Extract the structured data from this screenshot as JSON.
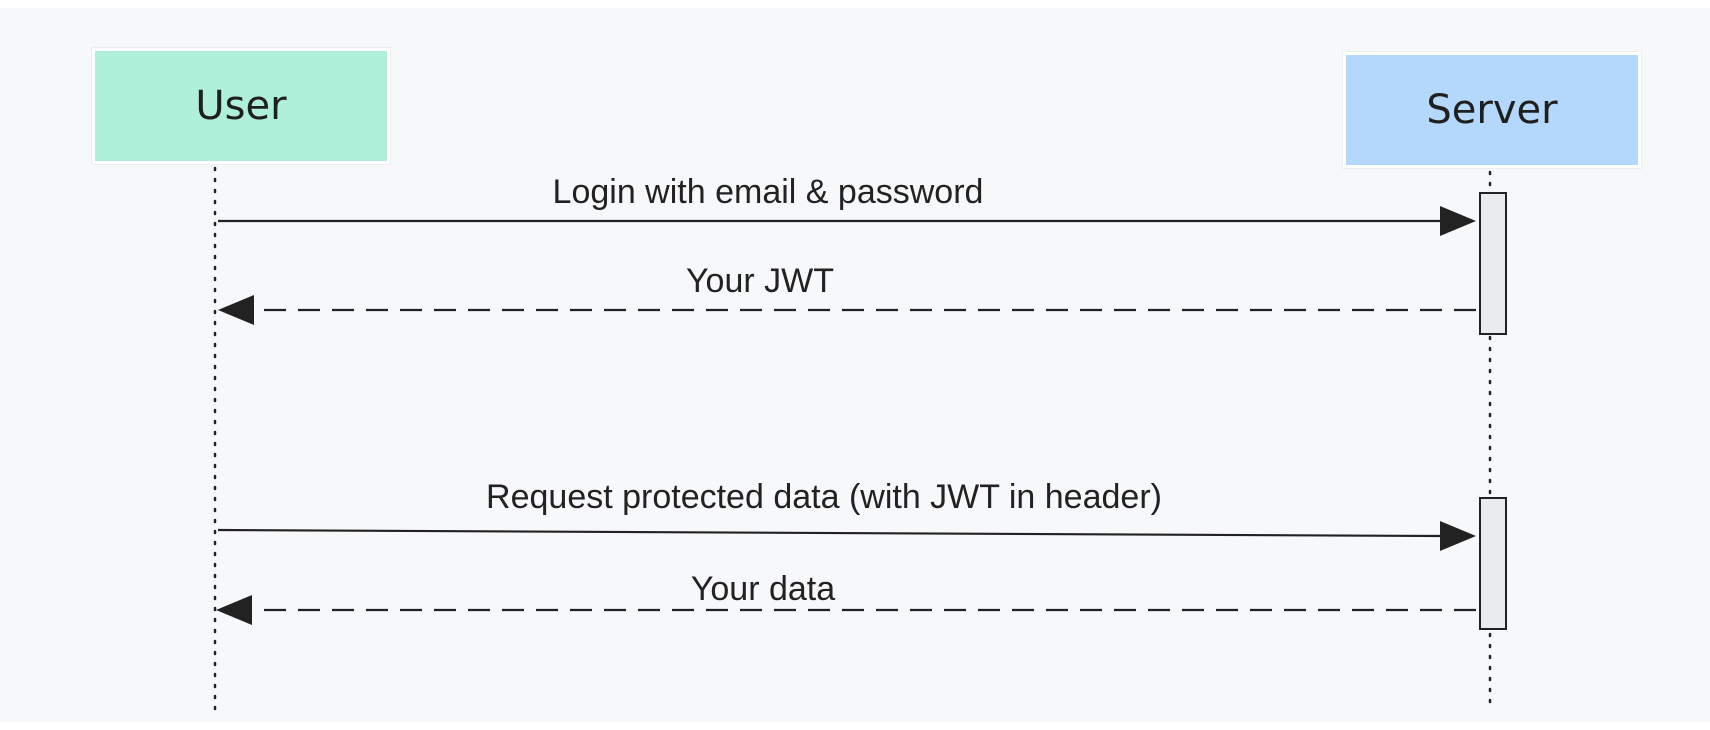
{
  "actors": {
    "user": "User",
    "server": "Server"
  },
  "messages": [
    {
      "label": "Login with email & password",
      "style": "solid"
    },
    {
      "label": "Your JWT",
      "style": "dashed"
    },
    {
      "label": "Request protected data (with JWT in header)",
      "style": "solid"
    },
    {
      "label": "Your data",
      "style": "dashed"
    }
  ],
  "colors": {
    "user_box": "#aef0d9",
    "server_box": "#b3d8fb",
    "background": "#f7f8fa",
    "activation": "#e9ebee",
    "line": "#222222"
  }
}
